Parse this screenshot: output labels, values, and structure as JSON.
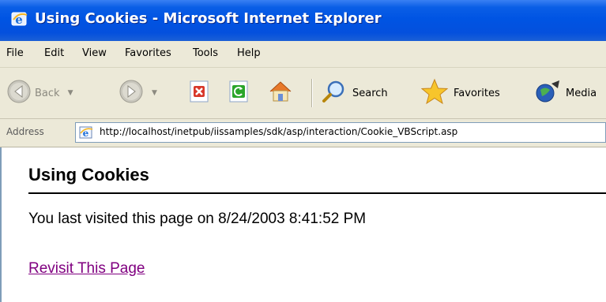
{
  "window": {
    "title": "Using Cookies - Microsoft Internet Explorer",
    "title_icon": "ie-icon"
  },
  "menu": {
    "items": [
      "File",
      "Edit",
      "View",
      "Favorites",
      "Tools",
      "Help"
    ]
  },
  "toolbar": {
    "back_label": "Back",
    "search_label": "Search",
    "favorites_label": "Favorites",
    "media_label": "Media",
    "icons": [
      "back-arrow-icon",
      "forward-arrow-icon",
      "stop-icon",
      "refresh-icon",
      "home-icon",
      "search-icon",
      "favorites-star-icon",
      "media-icon"
    ]
  },
  "address": {
    "label": "Address",
    "url": "http://localhost/inetpub/iissamples/sdk/asp/interaction/Cookie_VBScript.asp"
  },
  "page": {
    "heading": "Using Cookies",
    "visit_text": "You last visited this page on 8/24/2003 8:41:52 PM",
    "link_text": "Revisit This Page"
  },
  "colors": {
    "titlebar": "#0054e3",
    "chrome": "#ece9d8",
    "visited_link": "#800080"
  }
}
